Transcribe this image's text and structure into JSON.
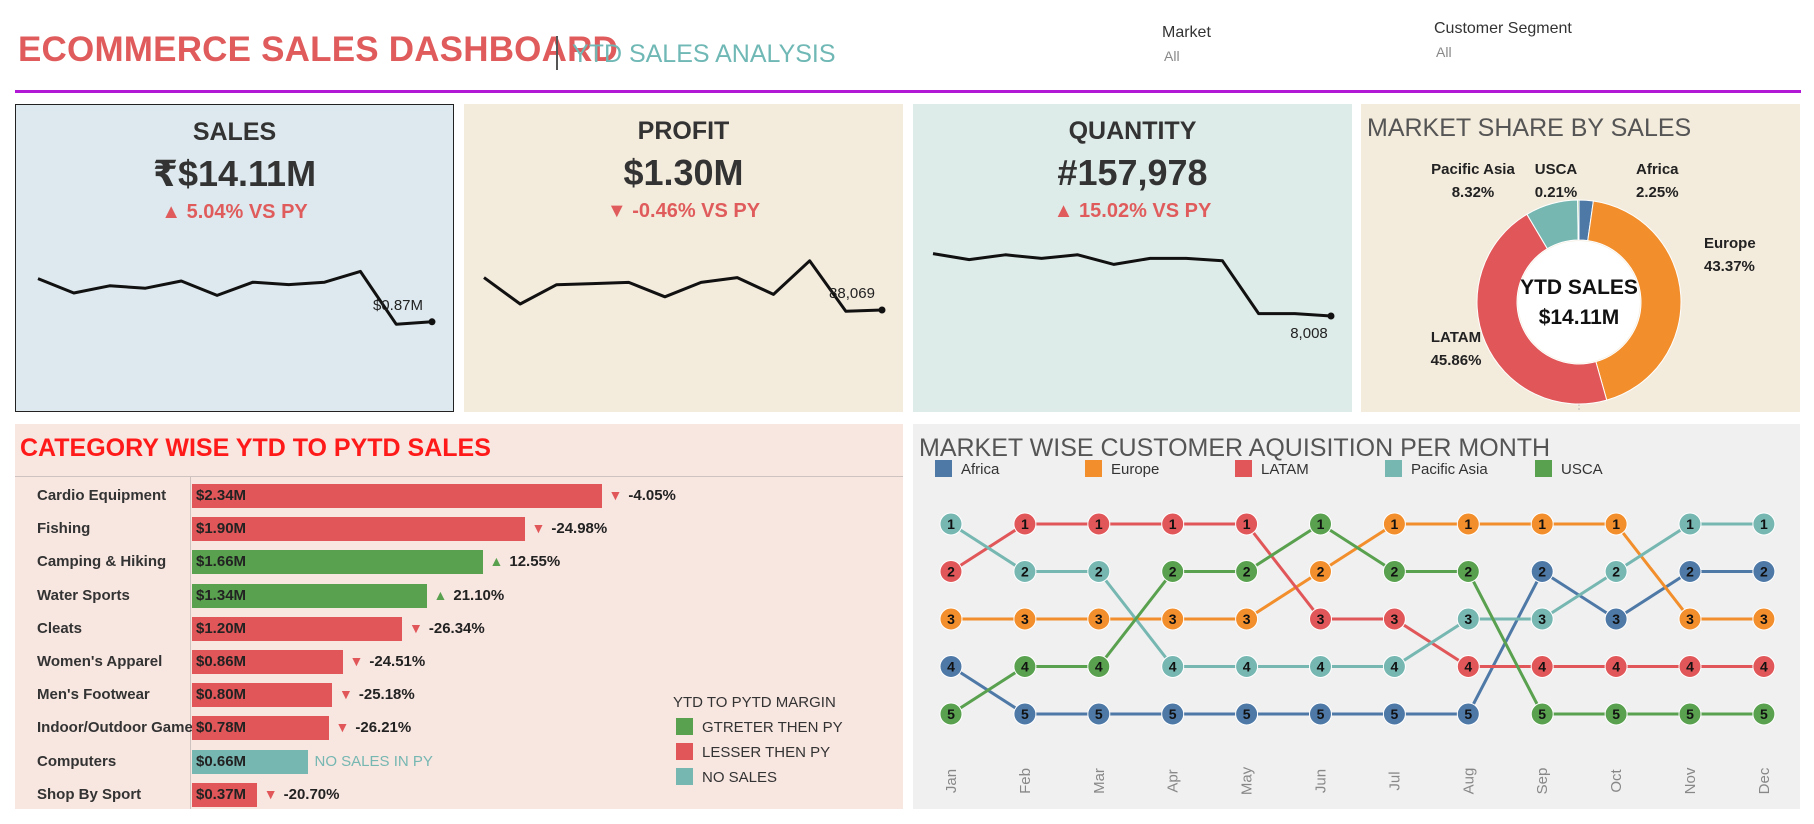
{
  "header": {
    "title": "ECOMMERCE SALES DASHBOARD",
    "subtitle": "YTD SALES ANALYSIS",
    "filters": [
      {
        "label": "Market",
        "value": "All"
      },
      {
        "label": "Customer Segment",
        "value": "All"
      }
    ]
  },
  "colors": {
    "red": "#e15759",
    "green": "#59a14f",
    "teal": "#76b7b2",
    "blue": "#4e79a7",
    "orange": "#f28e2b",
    "accent_line": "#b118d6"
  },
  "kpis": [
    {
      "title": "SALES",
      "value": "₹$14.11M",
      "delta_text": "5.04% VS PY",
      "direction": "up",
      "end_label": "$0.87M",
      "trend": [
        72,
        60,
        66,
        64,
        70,
        58,
        69,
        67,
        69,
        78,
        34,
        36
      ]
    },
    {
      "title": "PROFIT",
      "value": "$1.30M",
      "delta_text": "-0.46% VS PY",
      "direction": "down",
      "end_label": "88,069",
      "trend": [
        72,
        50,
        66,
        67,
        68,
        56,
        68,
        72,
        58,
        86,
        44,
        45
      ]
    },
    {
      "title": "QUANTITY",
      "value": "#157,978",
      "delta_text": "15.02% VS PY",
      "direction": "up",
      "end_label": "8,008",
      "trend": [
        92,
        87,
        91,
        88,
        91,
        83,
        88,
        88,
        86,
        42,
        42,
        40
      ]
    }
  ],
  "chart_data": [
    {
      "type": "pie",
      "title": "MARKET SHARE BY SALES",
      "center_label": "YTD SALES",
      "center_value": "$14.11M",
      "slices": [
        {
          "name": "Africa",
          "value": 2.25,
          "label": "2.25%",
          "color": "#4e79a7"
        },
        {
          "name": "Europe",
          "value": 43.37,
          "label": "43.37%",
          "color": "#f28e2b"
        },
        {
          "name": "LATAM",
          "value": 45.86,
          "label": "45.86%",
          "color": "#e15759"
        },
        {
          "name": "Pacific Asia",
          "value": 8.32,
          "label": "8.32%",
          "color": "#76b7b2"
        },
        {
          "name": "USCA",
          "value": 0.21,
          "label": "0.21%",
          "color": "#59a14f"
        }
      ]
    },
    {
      "type": "bar",
      "title": "CATEGORY WISE YTD TO PYTD SALES",
      "categories": [
        "Cardio Equipment",
        "Fishing",
        "Camping & Hiking",
        "Water Sports",
        "Cleats",
        "Women's Apparel",
        "Men's Footwear",
        "Indoor/Outdoor Games",
        "Computers",
        "Shop By Sport"
      ],
      "values": [
        2.34,
        1.9,
        1.66,
        1.34,
        1.2,
        0.86,
        0.8,
        0.78,
        0.66,
        0.37
      ],
      "value_labels": [
        "$2.34M",
        "$1.90M",
        "$1.66M",
        "$1.34M",
        "$1.20M",
        "$0.86M",
        "$0.80M",
        "$0.78M",
        "$0.66M",
        "$0.37M"
      ],
      "deltas": [
        "-4.05%",
        "-24.98%",
        "12.55%",
        "21.10%",
        "-26.34%",
        "-24.51%",
        "-25.18%",
        "-26.21%",
        "NO SALES IN PY",
        "-20.70%"
      ],
      "status": [
        "lesser",
        "lesser",
        "greater",
        "greater",
        "lesser",
        "lesser",
        "lesser",
        "lesser",
        "none",
        "lesser"
      ],
      "legend": {
        "title": "YTD TO PYTD MARGIN",
        "items": [
          {
            "label": "GTRETER THEN PY",
            "color": "#59a14f"
          },
          {
            "label": "LESSER THEN PY",
            "color": "#e15759"
          },
          {
            "label": "NO SALES",
            "color": "#76b7b2"
          }
        ]
      }
    },
    {
      "type": "line",
      "title": "MARKET WISE CUSTOMER AQUISITION PER MONTH",
      "x": [
        "Jan",
        "Feb",
        "Mar",
        "Apr",
        "May",
        "Jun",
        "Jul",
        "Aug",
        "Sep",
        "Oct",
        "Nov",
        "Dec"
      ],
      "y_reversed": true,
      "series": [
        {
          "name": "Africa",
          "color": "#4e79a7",
          "values": [
            4,
            5,
            5,
            5,
            5,
            5,
            5,
            5,
            2,
            3,
            2,
            2
          ]
        },
        {
          "name": "Europe",
          "color": "#f28e2b",
          "values": [
            3,
            3,
            3,
            3,
            3,
            2,
            1,
            1,
            1,
            1,
            3,
            3
          ]
        },
        {
          "name": "LATAM",
          "color": "#e15759",
          "values": [
            2,
            1,
            1,
            1,
            1,
            3,
            3,
            4,
            4,
            4,
            4,
            4
          ]
        },
        {
          "name": "Pacific Asia",
          "color": "#76b7b2",
          "values": [
            1,
            2,
            2,
            4,
            4,
            4,
            4,
            3,
            3,
            2,
            1,
            1
          ]
        },
        {
          "name": "USCA",
          "color": "#59a14f",
          "values": [
            5,
            4,
            4,
            2,
            2,
            1,
            2,
            2,
            5,
            5,
            5,
            5
          ]
        }
      ]
    }
  ]
}
